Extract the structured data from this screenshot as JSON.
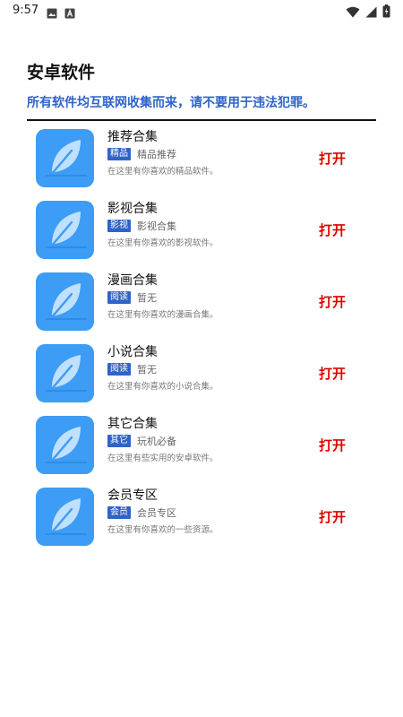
{
  "status_bar": {
    "time": "9:57",
    "left_icons": [
      "image-icon",
      "font-icon"
    ],
    "right_icons": [
      "wifi-icon",
      "signal-icon",
      "battery-icon"
    ]
  },
  "header": {
    "title": "安卓软件",
    "notice": "所有软件均互联网收集而来，请不要用于违法犯罪。"
  },
  "colors": {
    "accent_blue": "#2f63c8",
    "open_red": "#e00000",
    "icon_blue": "#3d9cf5"
  },
  "items": [
    {
      "title": "推荐合集",
      "badge": "精品",
      "subtitle": "精品推荐",
      "desc": "在这里有你喜欢的精品软件。",
      "action": "打开"
    },
    {
      "title": "影视合集",
      "badge": "影视",
      "subtitle": "影视合集",
      "desc": "在这里有你喜欢的影视软件。",
      "action": "打开"
    },
    {
      "title": "漫画合集",
      "badge": "阅读",
      "subtitle": "暂无",
      "desc": "在这里有你喜欢的漫画合集。",
      "action": "打开"
    },
    {
      "title": "小说合集",
      "badge": "阅读",
      "subtitle": "暂无",
      "desc": "在这里有你喜欢的小说合集。",
      "action": "打开"
    },
    {
      "title": "其它合集",
      "badge": "其它",
      "subtitle": "玩机必备",
      "desc": "在这里有些实用的安卓软件。",
      "action": "打开"
    },
    {
      "title": "会员专区",
      "badge": "会员",
      "subtitle": "会员专区",
      "desc": "在这里有你喜欢的一些资源。",
      "action": "打开"
    }
  ]
}
